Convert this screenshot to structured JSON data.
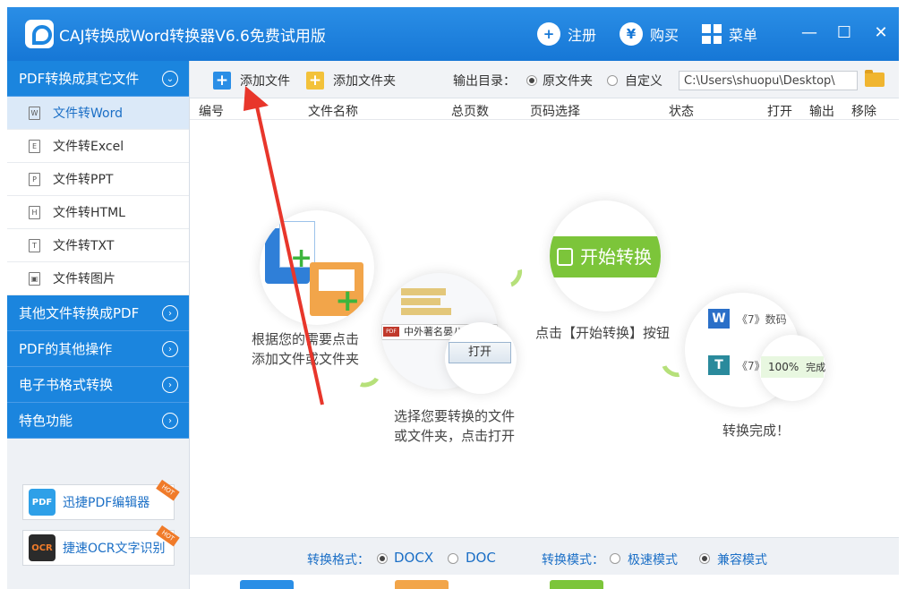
{
  "window": {
    "title": "CAJ转换成Word转换器V6.6免费试用版",
    "register_label": "注册",
    "buy_label": "购买",
    "menu_label": "菜单"
  },
  "sidebar": {
    "categories": [
      {
        "label": "PDF转换成其它文件"
      },
      {
        "label": "其他文件转换成PDF"
      },
      {
        "label": "PDF的其他操作"
      },
      {
        "label": "电子书格式转换"
      },
      {
        "label": "特色功能"
      }
    ],
    "items": [
      {
        "label": "文件转Word",
        "icon": "W"
      },
      {
        "label": "文件转Excel",
        "icon": "E"
      },
      {
        "label": "文件转PPT",
        "icon": "P"
      },
      {
        "label": "文件转HTML",
        "icon": "H"
      },
      {
        "label": "文件转TXT",
        "icon": "T"
      },
      {
        "label": "文件转图片",
        "icon": "▣"
      }
    ],
    "promos": [
      {
        "label": "迅捷PDF编辑器",
        "icon_text": "PDF",
        "color": "#2ea0e8",
        "badge": "HOT"
      },
      {
        "label": "捷速OCR文字识别",
        "icon_text": "OCR",
        "color": "#2b2b2b",
        "badge": "HOT"
      }
    ]
  },
  "toolbar": {
    "add_file": "添加文件",
    "add_folder": "添加文件夹",
    "output_label": "输出目录：",
    "option_original": "原文件夹",
    "option_custom": "自定义",
    "path": "C:\\Users\\shuopu\\Desktop\\"
  },
  "table": {
    "columns": [
      "编号",
      "文件名称",
      "总页数",
      "页码选择",
      "状态",
      "打开",
      "输出",
      "移除"
    ]
  },
  "guide": {
    "step1": "根据您的需要点击\n添加文件或文件夹",
    "step2": "选择您要转换的文件\n或文件夹，点击打开",
    "step3": "点击【开始转换】按钮",
    "step4": "转换完成！",
    "file_type_text": "中外著名晏八*.pdf,*.",
    "open_button": "打开",
    "start_button": "开始转换",
    "result_item1": "《7》数码",
    "result_item2": "《7》",
    "progress": "100%",
    "progress_status": "完成"
  },
  "bottom": {
    "format_label": "转换格式：",
    "format_docx": "DOCX",
    "format_doc": "DOC",
    "mode_label": "转换模式：",
    "mode_fast": "极速模式",
    "mode_compat": "兼容模式"
  },
  "colors": {
    "brand": "#1b85de",
    "accent_green": "#7cc53a",
    "arrow_red": "#e8362b"
  }
}
